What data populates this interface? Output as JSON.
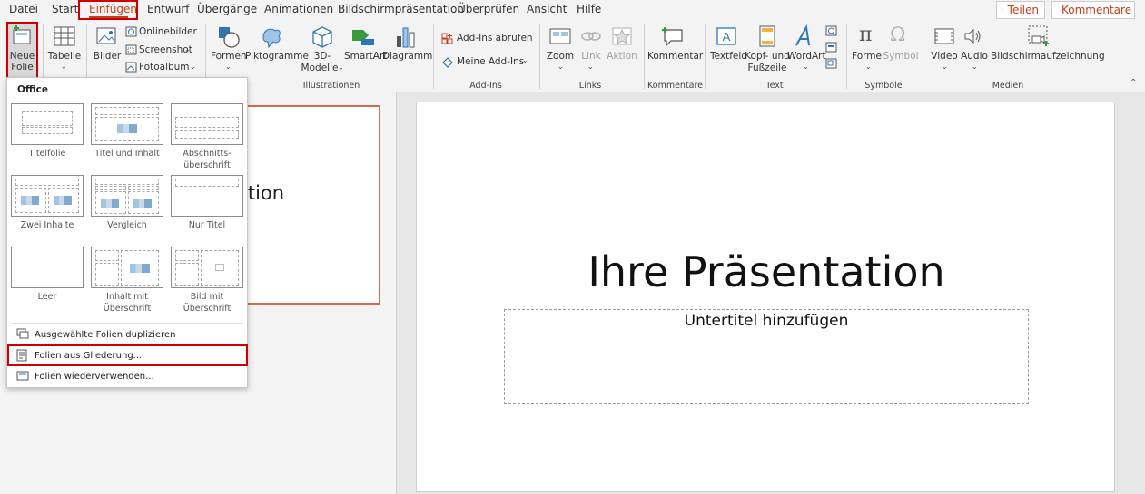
{
  "tabs": [
    "Datei",
    "Start",
    "Einfügen",
    "Entwurf",
    "Übergänge",
    "Animationen",
    "Bildschirmpräsentation",
    "Überprüfen",
    "Ansicht",
    "Hilfe"
  ],
  "share_label": "Teilen",
  "comments_label": "Kommentare",
  "ribbon": {
    "neue_folie_1": "Neue",
    "neue_folie_2": "Folie",
    "tabelle": "Tabelle",
    "bilder": "Bilder",
    "onlinebilder": "Onlinebilder",
    "screenshot": "Screenshot",
    "fotoalbum": "Fotoalbum",
    "formen": "Formen",
    "piktogramme": "Piktogramme",
    "modelle_1": "3D-",
    "modelle_2": "Modelle",
    "smartart": "SmartArt",
    "diagramm": "Diagramm",
    "addins_abrufen": "Add-Ins abrufen",
    "meine_addins": "Meine Add-Ins",
    "zoom": "Zoom",
    "link": "Link",
    "aktion": "Aktion",
    "kommentar": "Kommentar",
    "textfeld": "Textfeld",
    "kopf_1": "Kopf- und",
    "kopf_2": "Fußzeile",
    "wordart": "WordArt",
    "formel": "Formel",
    "symbol": "Symbol",
    "video": "Video",
    "audio": "Audio",
    "bildschirm": "Bildschirmaufzeichnung",
    "groups": {
      "illustrationen": "Illustrationen",
      "addins": "Add-Ins",
      "links": "Links",
      "kommentare": "Kommentare",
      "text": "Text",
      "symbole": "Symbole",
      "medien": "Medien"
    }
  },
  "dropdown": {
    "header": "Office",
    "layouts": [
      {
        "name1": "Titelfolie",
        "name2": ""
      },
      {
        "name1": "Titel und Inhalt",
        "name2": ""
      },
      {
        "name1": "Abschnitts-",
        "name2": "überschrift"
      },
      {
        "name1": "Zwei Inhalte",
        "name2": ""
      },
      {
        "name1": "Vergleich",
        "name2": ""
      },
      {
        "name1": "Nur Titel",
        "name2": ""
      },
      {
        "name1": "Leer",
        "name2": ""
      },
      {
        "name1": "Inhalt mit",
        "name2": "Überschrift"
      },
      {
        "name1": "Bild mit",
        "name2": "Überschrift"
      }
    ],
    "items": [
      "Ausgewählte Folien duplizieren",
      "Folien aus Gliederung...",
      "Folien wiederverwenden..."
    ]
  },
  "thumb_text": "ation",
  "slide": {
    "title": "Ihre Präsentation",
    "subtitle": "Untertitel hinzufügen"
  }
}
